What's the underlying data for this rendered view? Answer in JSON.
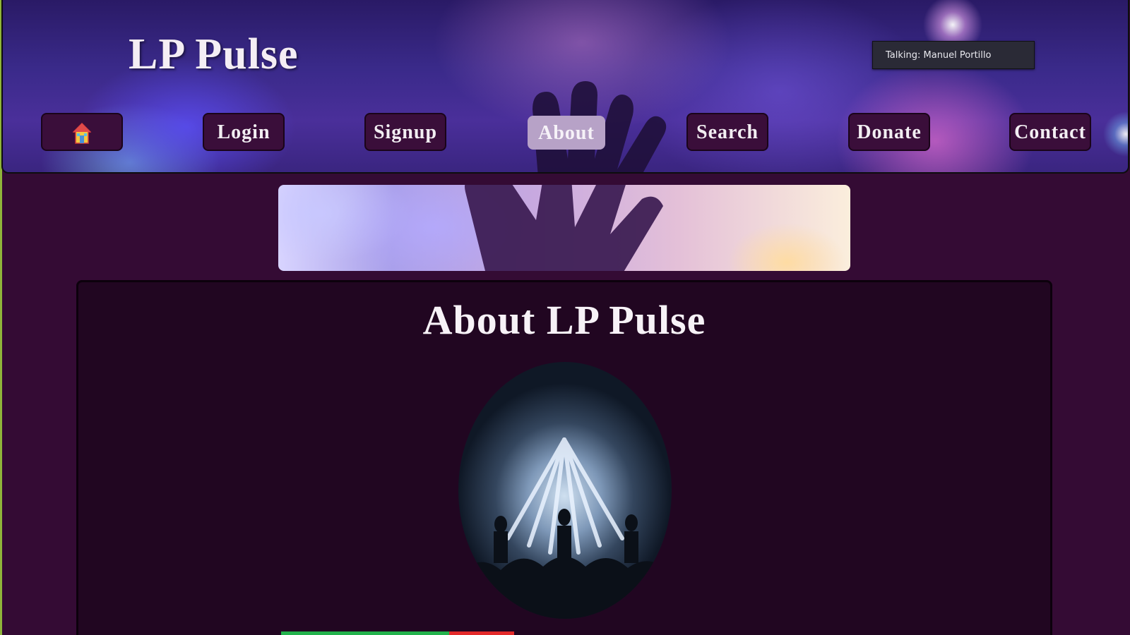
{
  "site": {
    "title": "LP Pulse"
  },
  "talking": {
    "text": "Talking: Manuel Portillo"
  },
  "nav": {
    "home_icon": "house-icon",
    "items": [
      {
        "label": "Login"
      },
      {
        "label": "Signup"
      },
      {
        "label": "About",
        "active": true
      },
      {
        "label": "Search"
      },
      {
        "label": "Donate"
      },
      {
        "label": "Contact"
      }
    ]
  },
  "main": {
    "heading": "About LP Pulse"
  },
  "colors": {
    "page_background": "#340b34",
    "panel_background": "#210621",
    "nav_button": "#3a0e3a",
    "nav_active": "#b7a2c7",
    "status_green": "#22b24c",
    "status_red": "#e32a2a"
  }
}
